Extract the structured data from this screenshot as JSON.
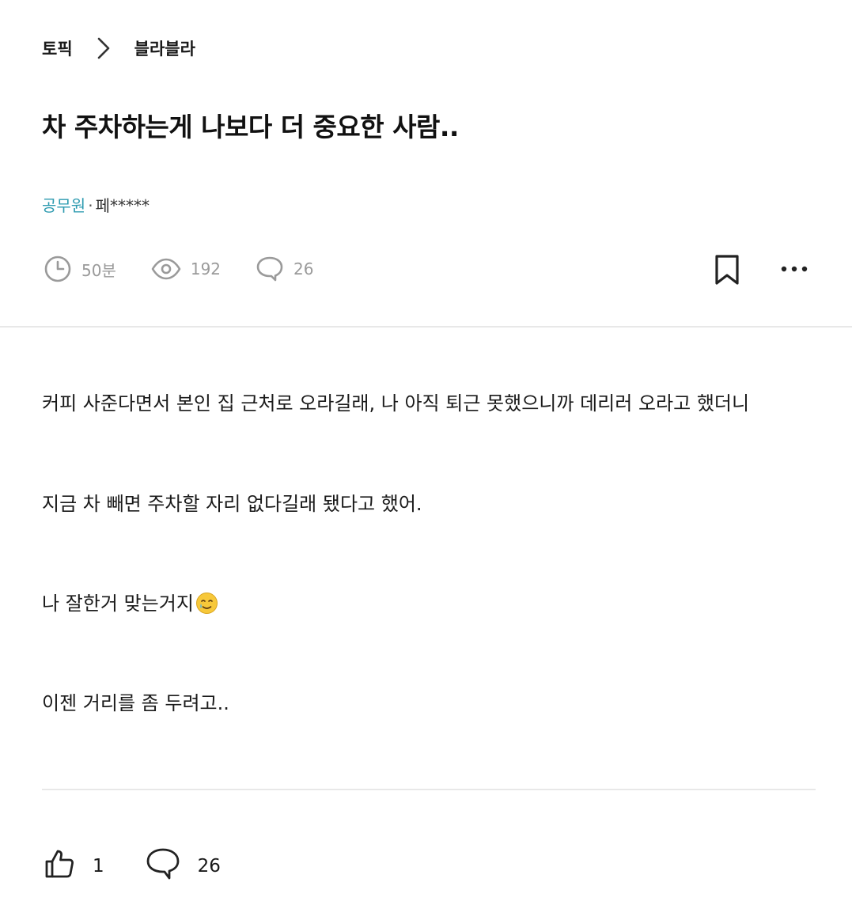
{
  "breadcrumb": {
    "root": "토픽",
    "current": "블라블라"
  },
  "post": {
    "title": "차 주차하는게 나보다 더 중요한 사람..",
    "company": "공무원",
    "separator": "·",
    "author": "페*****",
    "stats": {
      "time": "50분",
      "views": "192",
      "comments": "26"
    },
    "body": {
      "p1": "커피 사준다면서 본인 집 근처로 오라길래, 나 아직 퇴근 못했으니까 데리러 오라고 했더니",
      "p2": "지금 차 빼면 주차할 자리 없다길래 됐다고 했어.",
      "p3": "나 잘한거 맞는거지",
      "p4": "이젠 거리를 좀 두려고.."
    },
    "emoji": "crying-smile-emoji",
    "footer": {
      "likes": "1",
      "comments": "26"
    }
  },
  "colors": {
    "company": "#2e9bb0",
    "muted": "#9a9a9a",
    "divider": "#e8e8e8"
  },
  "icons": [
    "chevron-right-icon",
    "clock-icon",
    "eye-icon",
    "comment-icon",
    "bookmark-icon",
    "more-icon",
    "thumbs-up-icon",
    "comment-bubble-icon"
  ]
}
